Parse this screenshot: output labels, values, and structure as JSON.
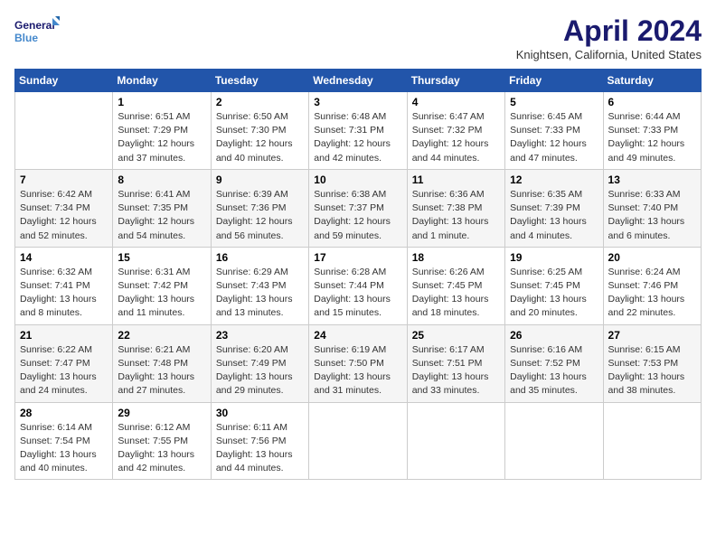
{
  "header": {
    "logo_line1": "General",
    "logo_line2": "Blue",
    "title": "April 2024",
    "location": "Knightsen, California, United States"
  },
  "days_of_week": [
    "Sunday",
    "Monday",
    "Tuesday",
    "Wednesday",
    "Thursday",
    "Friday",
    "Saturday"
  ],
  "weeks": [
    [
      {
        "day": "",
        "info": ""
      },
      {
        "day": "1",
        "info": "Sunrise: 6:51 AM\nSunset: 7:29 PM\nDaylight: 12 hours\nand 37 minutes."
      },
      {
        "day": "2",
        "info": "Sunrise: 6:50 AM\nSunset: 7:30 PM\nDaylight: 12 hours\nand 40 minutes."
      },
      {
        "day": "3",
        "info": "Sunrise: 6:48 AM\nSunset: 7:31 PM\nDaylight: 12 hours\nand 42 minutes."
      },
      {
        "day": "4",
        "info": "Sunrise: 6:47 AM\nSunset: 7:32 PM\nDaylight: 12 hours\nand 44 minutes."
      },
      {
        "day": "5",
        "info": "Sunrise: 6:45 AM\nSunset: 7:33 PM\nDaylight: 12 hours\nand 47 minutes."
      },
      {
        "day": "6",
        "info": "Sunrise: 6:44 AM\nSunset: 7:33 PM\nDaylight: 12 hours\nand 49 minutes."
      }
    ],
    [
      {
        "day": "7",
        "info": "Sunrise: 6:42 AM\nSunset: 7:34 PM\nDaylight: 12 hours\nand 52 minutes."
      },
      {
        "day": "8",
        "info": "Sunrise: 6:41 AM\nSunset: 7:35 PM\nDaylight: 12 hours\nand 54 minutes."
      },
      {
        "day": "9",
        "info": "Sunrise: 6:39 AM\nSunset: 7:36 PM\nDaylight: 12 hours\nand 56 minutes."
      },
      {
        "day": "10",
        "info": "Sunrise: 6:38 AM\nSunset: 7:37 PM\nDaylight: 12 hours\nand 59 minutes."
      },
      {
        "day": "11",
        "info": "Sunrise: 6:36 AM\nSunset: 7:38 PM\nDaylight: 13 hours\nand 1 minute."
      },
      {
        "day": "12",
        "info": "Sunrise: 6:35 AM\nSunset: 7:39 PM\nDaylight: 13 hours\nand 4 minutes."
      },
      {
        "day": "13",
        "info": "Sunrise: 6:33 AM\nSunset: 7:40 PM\nDaylight: 13 hours\nand 6 minutes."
      }
    ],
    [
      {
        "day": "14",
        "info": "Sunrise: 6:32 AM\nSunset: 7:41 PM\nDaylight: 13 hours\nand 8 minutes."
      },
      {
        "day": "15",
        "info": "Sunrise: 6:31 AM\nSunset: 7:42 PM\nDaylight: 13 hours\nand 11 minutes."
      },
      {
        "day": "16",
        "info": "Sunrise: 6:29 AM\nSunset: 7:43 PM\nDaylight: 13 hours\nand 13 minutes."
      },
      {
        "day": "17",
        "info": "Sunrise: 6:28 AM\nSunset: 7:44 PM\nDaylight: 13 hours\nand 15 minutes."
      },
      {
        "day": "18",
        "info": "Sunrise: 6:26 AM\nSunset: 7:45 PM\nDaylight: 13 hours\nand 18 minutes."
      },
      {
        "day": "19",
        "info": "Sunrise: 6:25 AM\nSunset: 7:45 PM\nDaylight: 13 hours\nand 20 minutes."
      },
      {
        "day": "20",
        "info": "Sunrise: 6:24 AM\nSunset: 7:46 PM\nDaylight: 13 hours\nand 22 minutes."
      }
    ],
    [
      {
        "day": "21",
        "info": "Sunrise: 6:22 AM\nSunset: 7:47 PM\nDaylight: 13 hours\nand 24 minutes."
      },
      {
        "day": "22",
        "info": "Sunrise: 6:21 AM\nSunset: 7:48 PM\nDaylight: 13 hours\nand 27 minutes."
      },
      {
        "day": "23",
        "info": "Sunrise: 6:20 AM\nSunset: 7:49 PM\nDaylight: 13 hours\nand 29 minutes."
      },
      {
        "day": "24",
        "info": "Sunrise: 6:19 AM\nSunset: 7:50 PM\nDaylight: 13 hours\nand 31 minutes."
      },
      {
        "day": "25",
        "info": "Sunrise: 6:17 AM\nSunset: 7:51 PM\nDaylight: 13 hours\nand 33 minutes."
      },
      {
        "day": "26",
        "info": "Sunrise: 6:16 AM\nSunset: 7:52 PM\nDaylight: 13 hours\nand 35 minutes."
      },
      {
        "day": "27",
        "info": "Sunrise: 6:15 AM\nSunset: 7:53 PM\nDaylight: 13 hours\nand 38 minutes."
      }
    ],
    [
      {
        "day": "28",
        "info": "Sunrise: 6:14 AM\nSunset: 7:54 PM\nDaylight: 13 hours\nand 40 minutes."
      },
      {
        "day": "29",
        "info": "Sunrise: 6:12 AM\nSunset: 7:55 PM\nDaylight: 13 hours\nand 42 minutes."
      },
      {
        "day": "30",
        "info": "Sunrise: 6:11 AM\nSunset: 7:56 PM\nDaylight: 13 hours\nand 44 minutes."
      },
      {
        "day": "",
        "info": ""
      },
      {
        "day": "",
        "info": ""
      },
      {
        "day": "",
        "info": ""
      },
      {
        "day": "",
        "info": ""
      }
    ]
  ]
}
